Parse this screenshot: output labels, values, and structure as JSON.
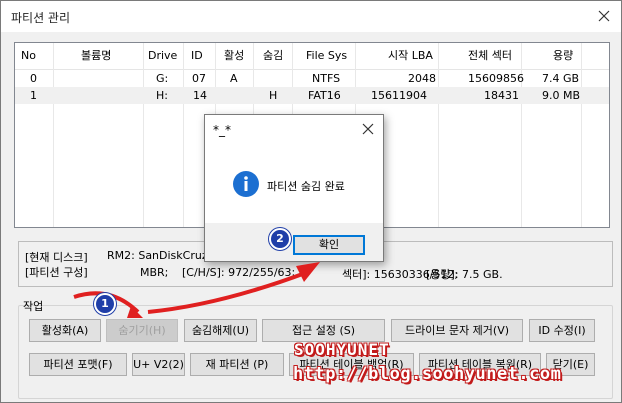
{
  "window": {
    "title": "파티션 관리"
  },
  "table": {
    "headers": [
      "No",
      "볼륨명",
      "Drive",
      "ID",
      "활성",
      "숨김",
      "File Sys",
      "시작 LBA",
      "전체 섹터",
      "용량"
    ],
    "rows": [
      [
        "0",
        "",
        "G:",
        "07",
        "A",
        "",
        "NTFS",
        "2048",
        "15609856",
        "7.4 GB"
      ],
      [
        "1",
        "",
        "H:",
        "14",
        "",
        "H",
        "FAT16",
        "15611904",
        "18431",
        "9.0 MB"
      ]
    ],
    "selected_row": 1
  },
  "info": {
    "disk_label": "[현재 디스크]",
    "disk_value": "RM2: SanDiskCruzer",
    "partition_label": "[파티션 구성]",
    "partition_type": "MBR;",
    "partition_chs": "[C/H/S]: 972/255/63;",
    "partition_sector_label": "섹터]: 15630336/512;",
    "partition_size": "[용량]: 7.5 GB."
  },
  "actions": {
    "group_label": "작업",
    "activate": "활성화(A)",
    "hide": "숨기기(H)",
    "unhide": "숨김해제(U)",
    "access": "접근 설정 (S)",
    "drive_letter_remove": "드라이브 문자 제거(V)",
    "id_edit": "ID 수정(I)",
    "format": "파티션 포맷(F)",
    "u_v2": "U+ V2(2)",
    "repartition": "재 파티션 (P)",
    "table_backup": "파티션 테이블 백업(R)",
    "table_restore": "파티션 테이블 복원(R)",
    "close": "닫기(E)"
  },
  "dialog": {
    "title": "*_*",
    "message": "파티션 숨김 완료",
    "ok": "확인"
  },
  "badges": {
    "one": "1",
    "two": "2"
  },
  "watermark": {
    "line1": "SOOHYUNET",
    "line2": "http://blog.soohyunet.com"
  },
  "colors": {
    "accent": "#0078d7",
    "badge": "#1f3ea8",
    "arrow": "#e02020"
  }
}
